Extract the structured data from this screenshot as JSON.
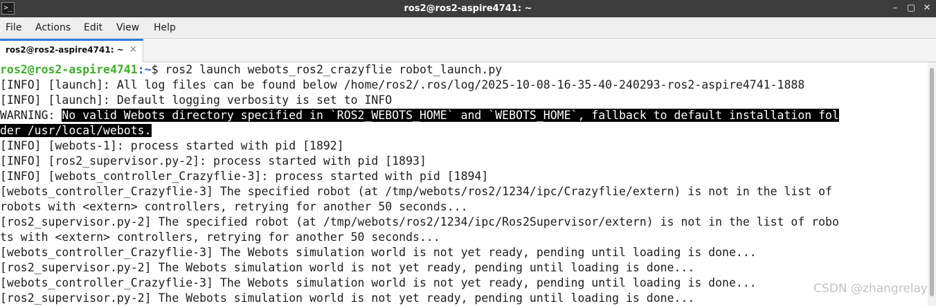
{
  "window": {
    "title": "ros2@ros2-aspire4741: ~",
    "app_icon": "terminal-icon",
    "minimize_glyph": "–",
    "maximize_glyph": "▢",
    "close_glyph": "✕"
  },
  "menu": {
    "items": [
      "File",
      "Actions",
      "Edit",
      "View",
      "Help"
    ]
  },
  "tab": {
    "label": "ros2@ros2-aspire4741: ~",
    "close_glyph": "×",
    "accent_color": "#2e7fd6"
  },
  "terminal": {
    "prompt_user": "ros2@ros2-aspire4741",
    "prompt_path": ":~",
    "prompt_symbol": "$ ",
    "command": "ros2 launch webots_ros2_crazyflie robot_launch.py",
    "warning_prefix": "WARNING: ",
    "warning_selected_1": "No valid Webots directory specified in `ROS2_WEBOTS_HOME` and `WEBOTS_HOME`, fallback to default installation fol",
    "warning_selected_2": "der /usr/local/webots.",
    "lines": [
      "[INFO] [launch]: All log files can be found below /home/ros2/.ros/log/2025-10-08-16-35-40-240293-ros2-aspire4741-1888",
      "[INFO] [launch]: Default logging verbosity is set to INFO",
      "[INFO] [webots-1]: process started with pid [1892]",
      "[INFO] [ros2_supervisor.py-2]: process started with pid [1893]",
      "[INFO] [webots_controller_Crazyflie-3]: process started with pid [1894]",
      "[webots_controller_Crazyflie-3] The specified robot (at /tmp/webots/ros2/1234/ipc/Crazyflie/extern) is not in the list of",
      "robots with <extern> controllers, retrying for another 50 seconds...",
      "[ros2_supervisor.py-2] The specified robot (at /tmp/webots/ros2/1234/ipc/Ros2Supervisor/extern) is not in the list of robo",
      "ts with <extern> controllers, retrying for another 50 seconds...",
      "[webots_controller_Crazyflie-3] The Webots simulation world is not yet ready, pending until loading is done...",
      "[ros2_supervisor.py-2] The Webots simulation world is not yet ready, pending until loading is done...",
      "[webots_controller_Crazyflie-3] The Webots simulation world is not yet ready, pending until loading is done...",
      "[ros2_supervisor.py-2] The Webots simulation world is not yet ready, pending until loading is done..."
    ],
    "colors": {
      "prompt_user": "#3fae2a",
      "prompt_path": "#2b62c8",
      "selection_bg": "#000000",
      "selection_fg": "#ffffff"
    }
  },
  "watermark": "CSDN @zhangrelay"
}
